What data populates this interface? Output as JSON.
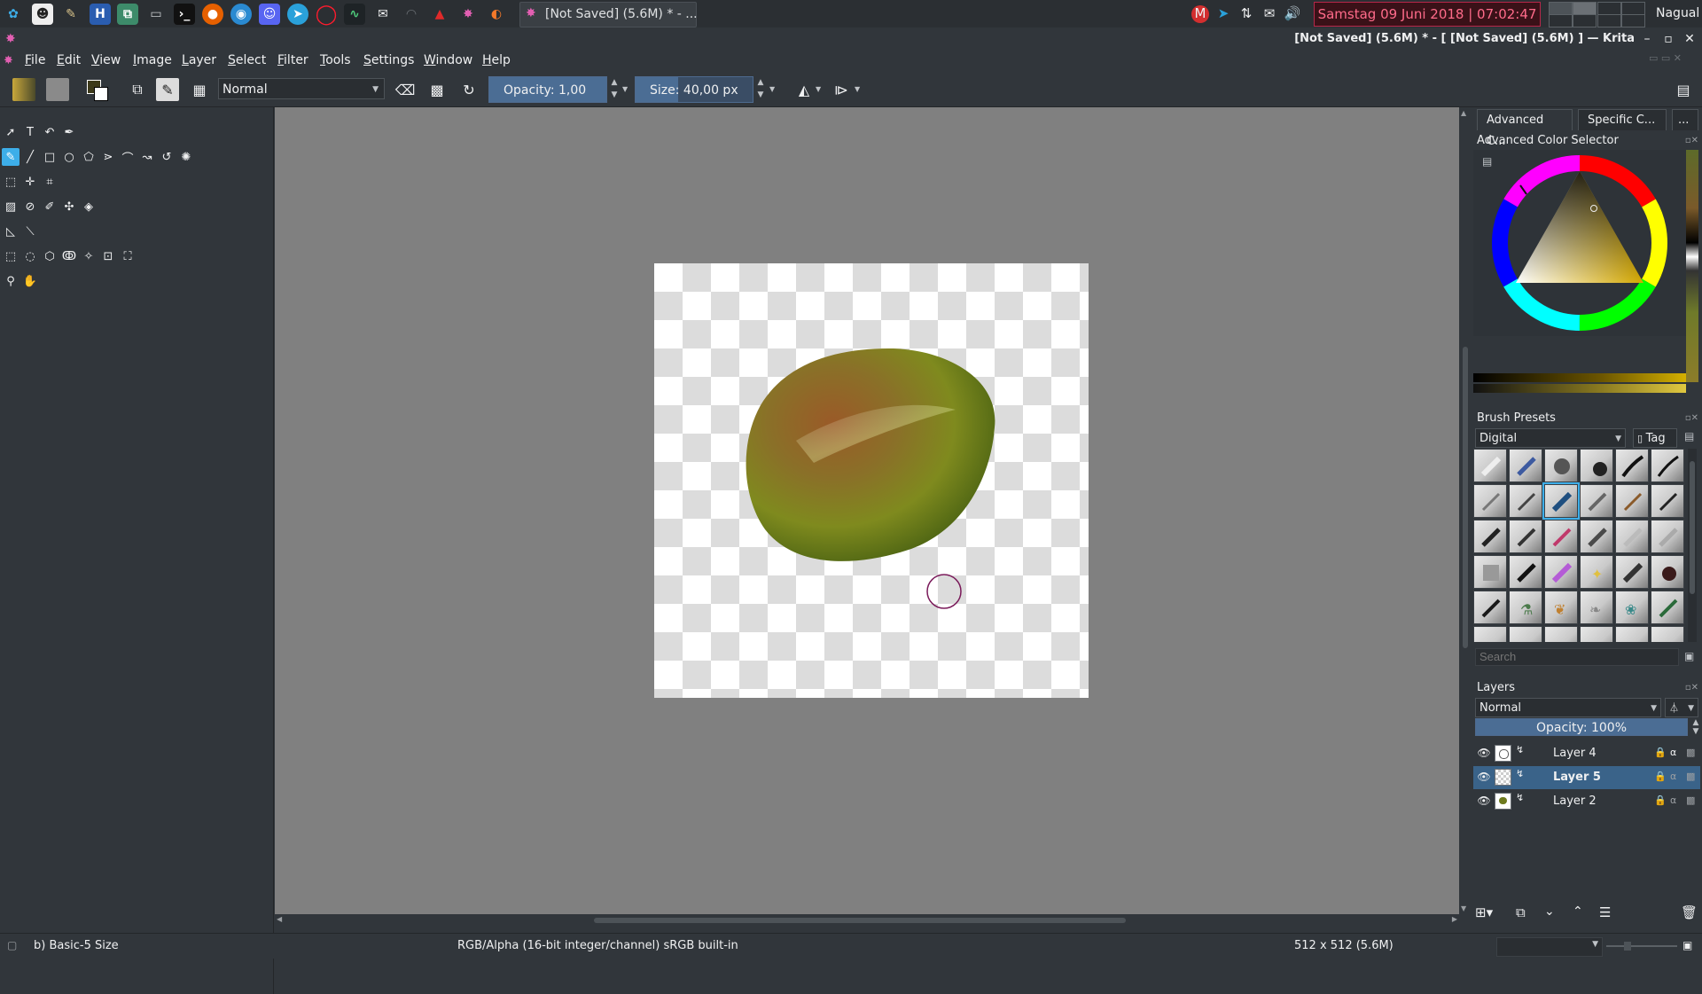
{
  "panel": {
    "task_title": "[Not Saved]  (5.6M) * - ...",
    "clock": "Samstag 09 Juni 2018 | 07:02:47 |",
    "user": "Nagual"
  },
  "window": {
    "title": "[Not Saved]  (5.6M) * - [ [Not Saved]  (5.6M) ] — Krita"
  },
  "menu": [
    "File",
    "Edit",
    "View",
    "Image",
    "Layer",
    "Select",
    "Filter",
    "Tools",
    "Settings",
    "Window",
    "Help"
  ],
  "tool_options": {
    "blend_mode": "Normal",
    "opacity_label": "Opacity:  1,00",
    "opacity_value": 1.0,
    "size_label": "Size:  40,00 px",
    "size_value": 40
  },
  "dockers": {
    "tabs": [
      "Advanced C...",
      "Specific C...",
      "..."
    ],
    "color_selector_title": "Advanced Color Selector",
    "brush_presets_title": "Brush Presets",
    "preset_tag": "Digital",
    "tag_button": "Tag",
    "search_placeholder": "Search",
    "layers_title": "Layers",
    "layer_blend": "Normal",
    "layer_opacity_label": "Opacity:  100%",
    "layer_opacity_value": 1.0,
    "layers": [
      {
        "name": "Layer 4",
        "selected": false
      },
      {
        "name": "Layer 5",
        "selected": true
      },
      {
        "name": "Layer 2",
        "selected": false
      }
    ]
  },
  "status": {
    "brush": "b) Basic-5 Size",
    "color_space": "RGB/Alpha (16-bit integer/channel)  sRGB built-in",
    "image_size": "512 x 512 (5.6M)"
  },
  "colors": {
    "accent": "#3daee9",
    "selected_layer": "#3a6389",
    "fruit_green": "#6e8a1e",
    "fruit_red": "#9a5a28",
    "brush_cursor": "#7a1a5a"
  },
  "icons": [
    "krita-logo-icon",
    "firefox-icon",
    "telegram-icon",
    "opera-icon",
    "discord-icon",
    "blender-icon",
    "terminal-icon",
    "folder-icon",
    "wifi-icon",
    "volume-icon",
    "mail-icon",
    "eye-icon",
    "gear-icon",
    "brush-icon",
    "eraser-icon",
    "mirror-icon"
  ]
}
